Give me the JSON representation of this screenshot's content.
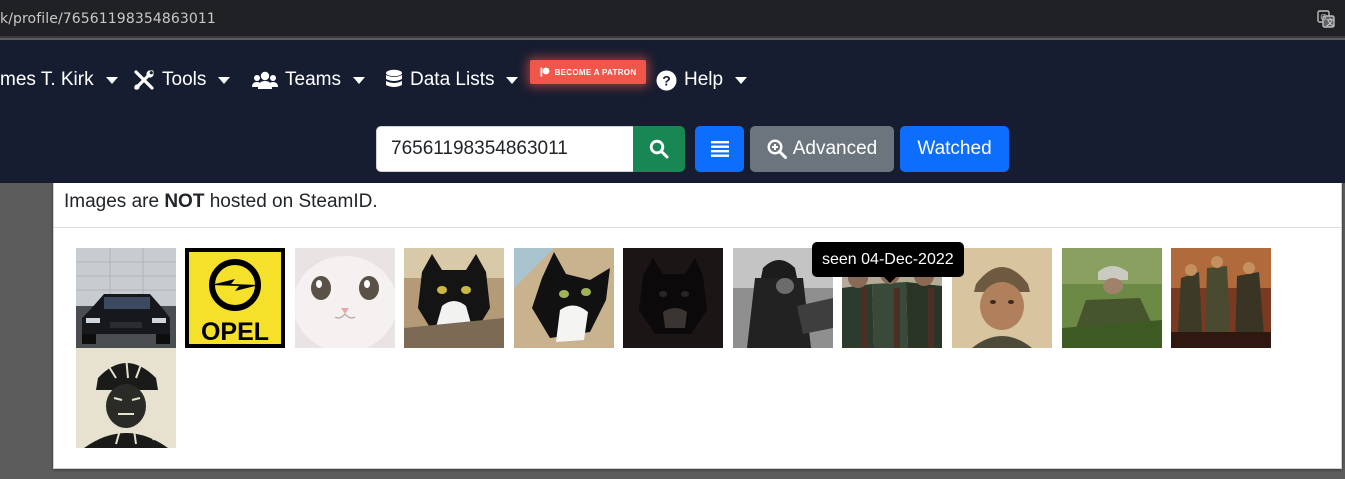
{
  "browser": {
    "url": "k/profile/76561198354863011",
    "translate_icon": "translate-icon"
  },
  "nav": {
    "user_label": "mes T. Kirk",
    "tools_label": "Tools",
    "teams_label": "Teams",
    "datalists_label": "Data Lists",
    "patron_label": "BECOME A PATRON",
    "help_label": "Help"
  },
  "search": {
    "value": "76561198354863011",
    "advanced_label": "Advanced",
    "watched_label": "Watched"
  },
  "content": {
    "notice_prefix": "Images are ",
    "notice_bold": "NOT",
    "notice_suffix": " hosted on SteamID.",
    "opel_text": "OPEL",
    "tooltip": "seen 04-Dec-2022"
  },
  "colors": {
    "navbar": "#161d30",
    "success": "#198754",
    "primary": "#0d6efd",
    "secondary": "#6c757d",
    "patron": "#f0564a"
  }
}
